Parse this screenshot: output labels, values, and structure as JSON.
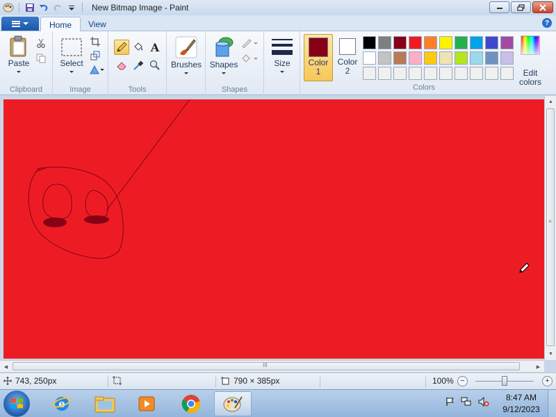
{
  "window": {
    "title": "New Bitmap Image - Paint",
    "minimize_icon": "minimize-icon",
    "maximize_icon": "restore-icon",
    "close_icon": "close-icon"
  },
  "ribbon_tabs": [
    {
      "label": "Home",
      "active": true
    },
    {
      "label": "View",
      "active": false
    }
  ],
  "groups": {
    "clipboard": {
      "label": "Clipboard",
      "paste": "Paste"
    },
    "image": {
      "label": "Image",
      "select": "Select"
    },
    "tools": {
      "label": "Tools",
      "text_glyph": "A"
    },
    "brushes": {
      "label": "Brushes"
    },
    "shapes": {
      "label": "Shapes",
      "shapes_btn": "Shapes"
    },
    "size": {
      "label": "Size"
    },
    "colors": {
      "label": "Colors",
      "color1": {
        "label": "Color",
        "num": "1",
        "value": "#880015"
      },
      "color2": {
        "label": "Color",
        "num": "2",
        "value": "#ffffff"
      },
      "edit_colors": "Edit colors",
      "palette_row1": [
        "#000000",
        "#7f7f7f",
        "#880015",
        "#ed1c24",
        "#ff7f27",
        "#fff200",
        "#22b14c",
        "#00a2e8",
        "#3f48cc",
        "#a349a4"
      ],
      "palette_row2": [
        "#ffffff",
        "#c3c3c3",
        "#b97a57",
        "#ffaec9",
        "#ffc90e",
        "#efe4b0",
        "#b5e61d",
        "#99d9ea",
        "#7092be",
        "#c8bfe7"
      ],
      "palette_row3": [
        "#f0f0f0",
        "#f0f0f0",
        "#f0f0f0",
        "#f0f0f0",
        "#f0f0f0",
        "#f0f0f0",
        "#f0f0f0",
        "#f0f0f0",
        "#f0f0f0",
        "#f0f0f0"
      ]
    }
  },
  "canvas": {
    "background": "#ed1c24",
    "stroke_color": "#880015"
  },
  "status": {
    "cursor_pos": "743, 250px",
    "canvas_size": "790 × 385px",
    "zoom": "100%",
    "zoom_level": 1.0
  },
  "taskbar": {
    "time": "8:47 AM",
    "date": "9/12/2023",
    "apps": [
      "internet-explorer",
      "file-explorer",
      "media-player",
      "chrome",
      "paint"
    ]
  }
}
